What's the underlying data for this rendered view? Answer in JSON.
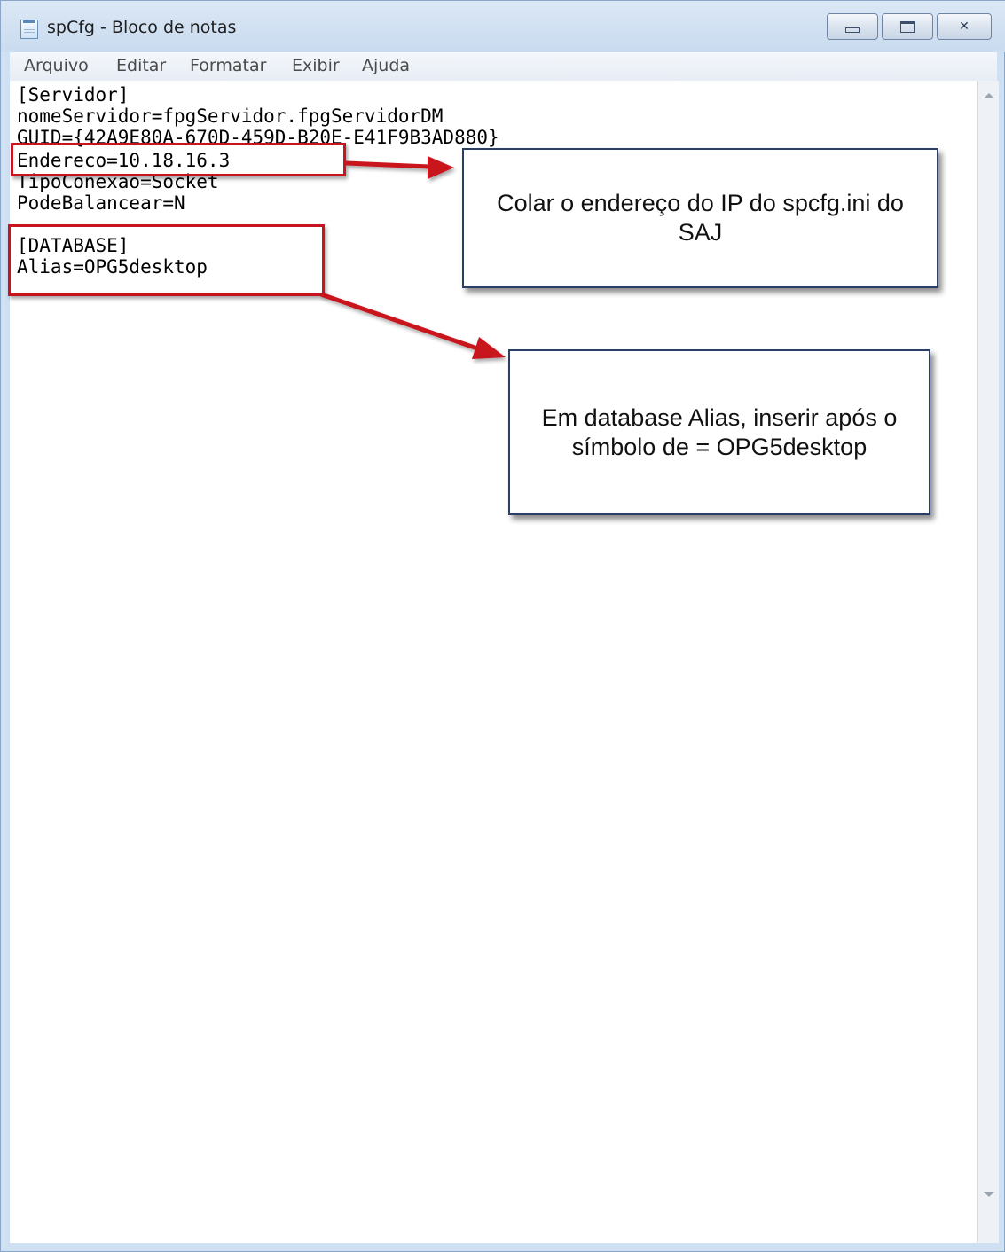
{
  "window": {
    "title": "spCfg - Bloco de notas",
    "controls": {
      "minimize": "minimize-icon",
      "maximize": "maximize-icon",
      "close": "✕"
    }
  },
  "menu": [
    "Arquivo",
    "Editar",
    "Formatar",
    "Exibir",
    "Ajuda"
  ],
  "editor": {
    "lines": [
      "[Servidor]",
      "nomeServidor=fpgServidor.fpgServidorDM",
      "GUID={42A9E80A-670D-459D-B20E-E41F9B3AD880}",
      "Endereco=10.18.16.3",
      "TipoConexao=Socket",
      "PodeBalancear=N",
      "",
      "[DATABASE]",
      "Alias=OPG5desktop"
    ]
  },
  "annotations": {
    "callout_ip": "Colar o endereço do IP do spcfg.ini do SAJ",
    "callout_alias": "Em database Alias, inserir após o símbolo de = OPG5desktop",
    "highlight_color": "#c8141e"
  }
}
